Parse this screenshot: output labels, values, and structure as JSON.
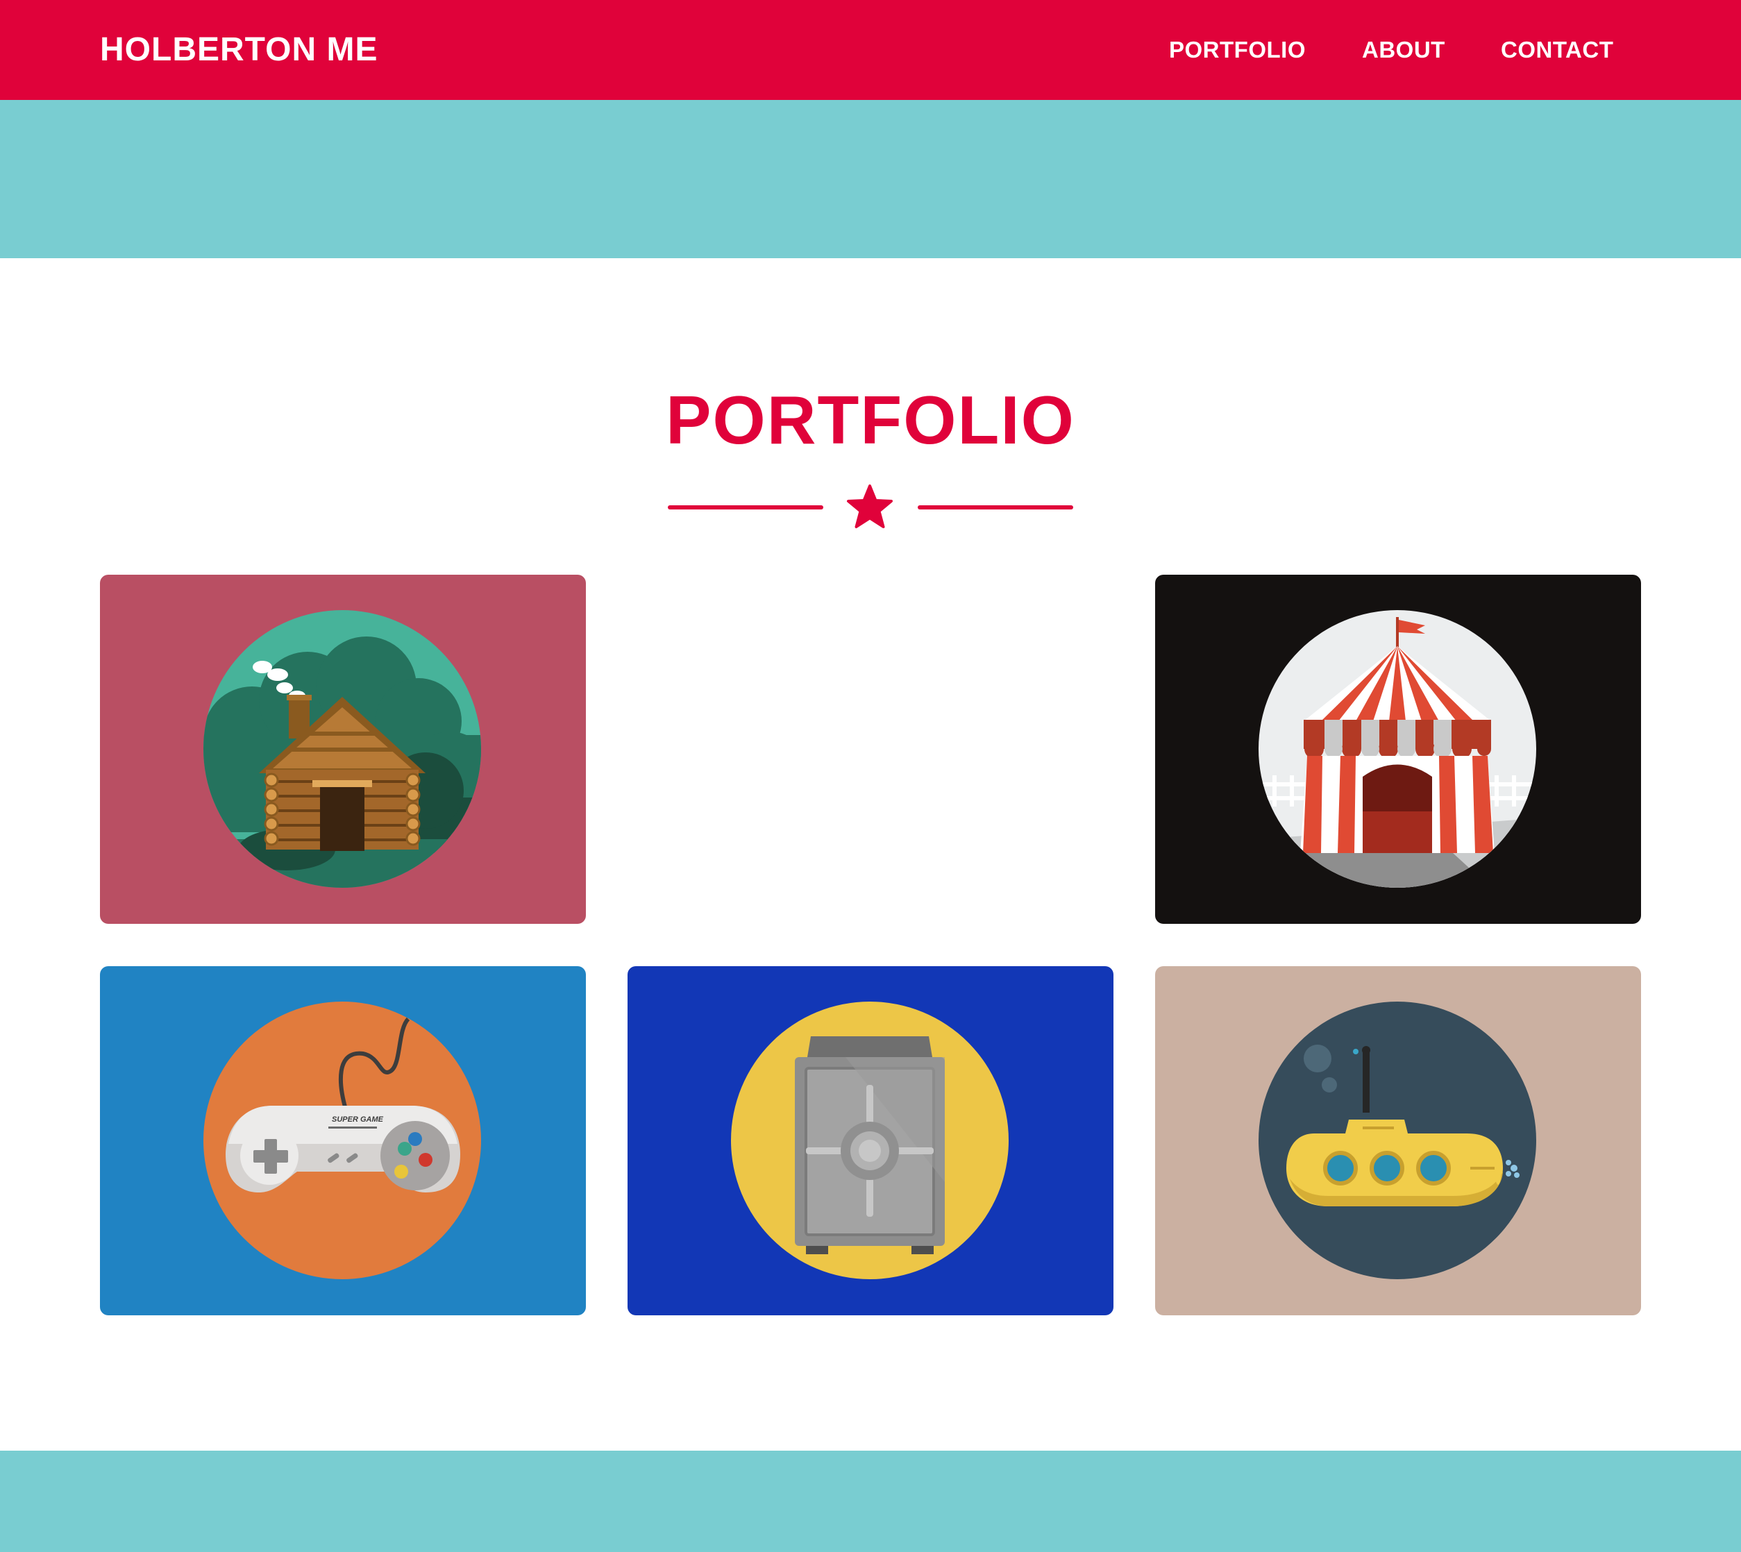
{
  "header": {
    "brand": "HOLBERTON ME",
    "nav": [
      {
        "label": "PORTFOLIO"
      },
      {
        "label": "ABOUT"
      },
      {
        "label": "CONTACT"
      }
    ]
  },
  "portfolio": {
    "title": "PORTFOLIO",
    "divider_icon": "star-icon",
    "items": [
      {
        "icon": "log-cabin-icon",
        "background": "#b94f63"
      },
      {
        "icon": "circus-tent-icon",
        "background": "#141110"
      },
      {
        "icon": "game-controller-icon",
        "background": "#2083c3",
        "caption": "SUPER GAME"
      },
      {
        "icon": "safe-icon",
        "background": "#1237b6"
      },
      {
        "icon": "submarine-icon",
        "background": "#cbb0a1"
      }
    ]
  },
  "colors": {
    "primary": "#e0023a",
    "band": "#79cdd1",
    "background": "#ffffff"
  }
}
